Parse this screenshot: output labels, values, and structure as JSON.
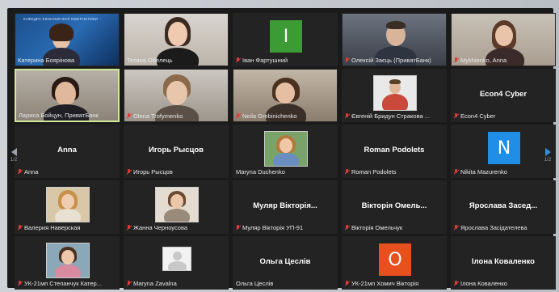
{
  "meeting": {
    "page_indicator_left": "1/2",
    "page_indicator_right": "1/2"
  },
  "colors": {
    "active_border": "#cfe89a",
    "muted_mic": "#e03b3b",
    "green_avatar": "#3d9b35",
    "blue_avatar": "#1e8ee6",
    "orange_avatar": "#e8501e"
  },
  "participants": [
    {
      "name": "Катерина Боярінова",
      "muted": false,
      "type": "video",
      "banner": "КАФЕДРА ЕКОНОМІЧНОЇ КІБЕРНЕТИКИ"
    },
    {
      "name": "Тетяна Обелець",
      "muted": false,
      "type": "video"
    },
    {
      "name": "Іван Фартушний",
      "muted": true,
      "type": "letter",
      "letter": "I",
      "color": "#3d9b35"
    },
    {
      "name": "Олексій Заєць (ПриватБанк)",
      "muted": true,
      "type": "video"
    },
    {
      "name": "Mykhienko, Anna",
      "muted": true,
      "type": "video"
    },
    {
      "name": "Лариса Бойцун, ПриватБанк",
      "muted": false,
      "type": "video",
      "active": true
    },
    {
      "name": "Olena Trofymenko",
      "muted": true,
      "type": "video"
    },
    {
      "name": "Neila Grebinichenko",
      "muted": true,
      "type": "video"
    },
    {
      "name": "Євгеній Бридун Стракова ...",
      "muted": true,
      "type": "photo"
    },
    {
      "name": "Econ4 Cyber",
      "muted": true,
      "type": "text",
      "display": "Econ4 Cyber"
    },
    {
      "name": "Anna",
      "muted": true,
      "type": "text",
      "display": "Anna"
    },
    {
      "name": "Игорь Рысцов",
      "muted": true,
      "type": "text",
      "display": "Игорь Рысцов"
    },
    {
      "name": "Maryna Duchenko",
      "muted": false,
      "type": "photo"
    },
    {
      "name": "Roman Podolets",
      "muted": true,
      "type": "text",
      "display": "Roman Podolets"
    },
    {
      "name": "Nikita Mazurenko",
      "muted": true,
      "type": "letter",
      "letter": "N",
      "color": "#1e8ee6"
    },
    {
      "name": "Валерия Наверская",
      "muted": true,
      "type": "photo"
    },
    {
      "name": "Жанна Черноусова",
      "muted": true,
      "type": "photo"
    },
    {
      "name": "Муляр Вікторія УП-91",
      "muted": true,
      "type": "text",
      "display": "Муляр Вікторія..."
    },
    {
      "name": "Вікторія Омельчук",
      "muted": true,
      "type": "text",
      "display": "Вікторія Омель..."
    },
    {
      "name": "Ярослава Засідателева",
      "muted": true,
      "type": "text",
      "display": "Ярослава Засед..."
    },
    {
      "name": "УК-21мп Степанчук Катер...",
      "muted": true,
      "type": "photo"
    },
    {
      "name": "Maryna Zavalna",
      "muted": true,
      "type": "placeholder"
    },
    {
      "name": "Ольга Цеслів",
      "muted": false,
      "type": "text",
      "display": "Ольга Цеслів"
    },
    {
      "name": "УК-21мп Хомич Вікторія",
      "muted": true,
      "type": "letter",
      "letter": "O",
      "color": "#e8501e"
    },
    {
      "name": "Ілона Коваленко",
      "muted": true,
      "type": "text",
      "display": "Ілона Коваленко"
    }
  ]
}
